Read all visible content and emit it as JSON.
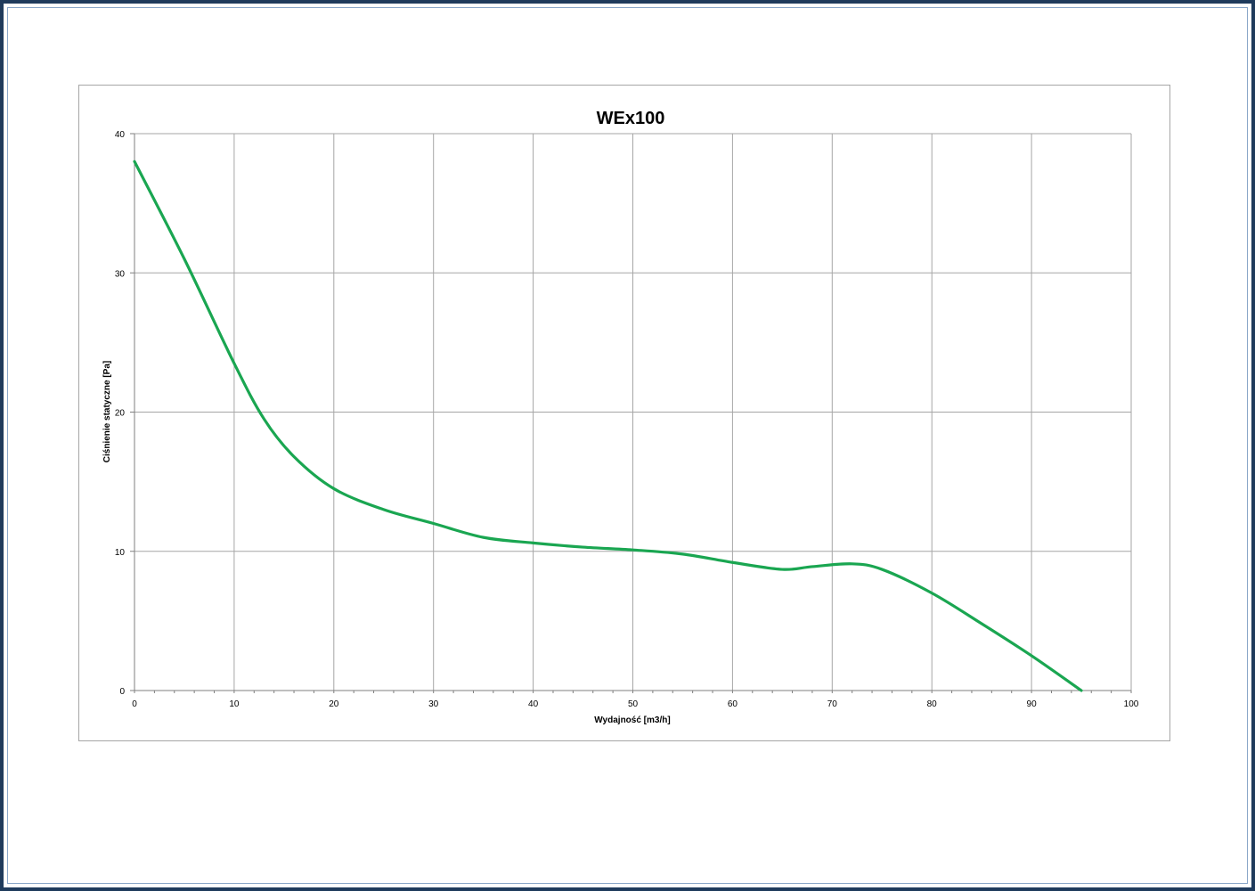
{
  "chart_data": {
    "type": "line",
    "title": "WEx100",
    "xlabel": "Wydajność [m3/h]",
    "ylabel": "Ciśnienie statyczne [Pa]",
    "xlim": [
      0,
      100
    ],
    "ylim": [
      0,
      40
    ],
    "x_ticks": [
      0,
      10,
      20,
      30,
      40,
      50,
      60,
      70,
      80,
      90,
      100
    ],
    "y_ticks": [
      0,
      10,
      20,
      30,
      40
    ],
    "grid": true,
    "legend": "none",
    "series": [
      {
        "color": "#1aa651",
        "x": [
          0,
          5,
          10,
          13,
          16,
          20,
          25,
          30,
          35,
          40,
          45,
          50,
          55,
          60,
          65,
          68,
          72,
          75,
          80,
          85,
          90,
          95
        ],
        "y": [
          38,
          31,
          23.5,
          19.5,
          16.8,
          14.5,
          13,
          12,
          11,
          10.6,
          10.3,
          10.1,
          9.8,
          9.2,
          8.7,
          8.9,
          9.1,
          8.7,
          7,
          4.8,
          2.5,
          0
        ]
      }
    ]
  }
}
